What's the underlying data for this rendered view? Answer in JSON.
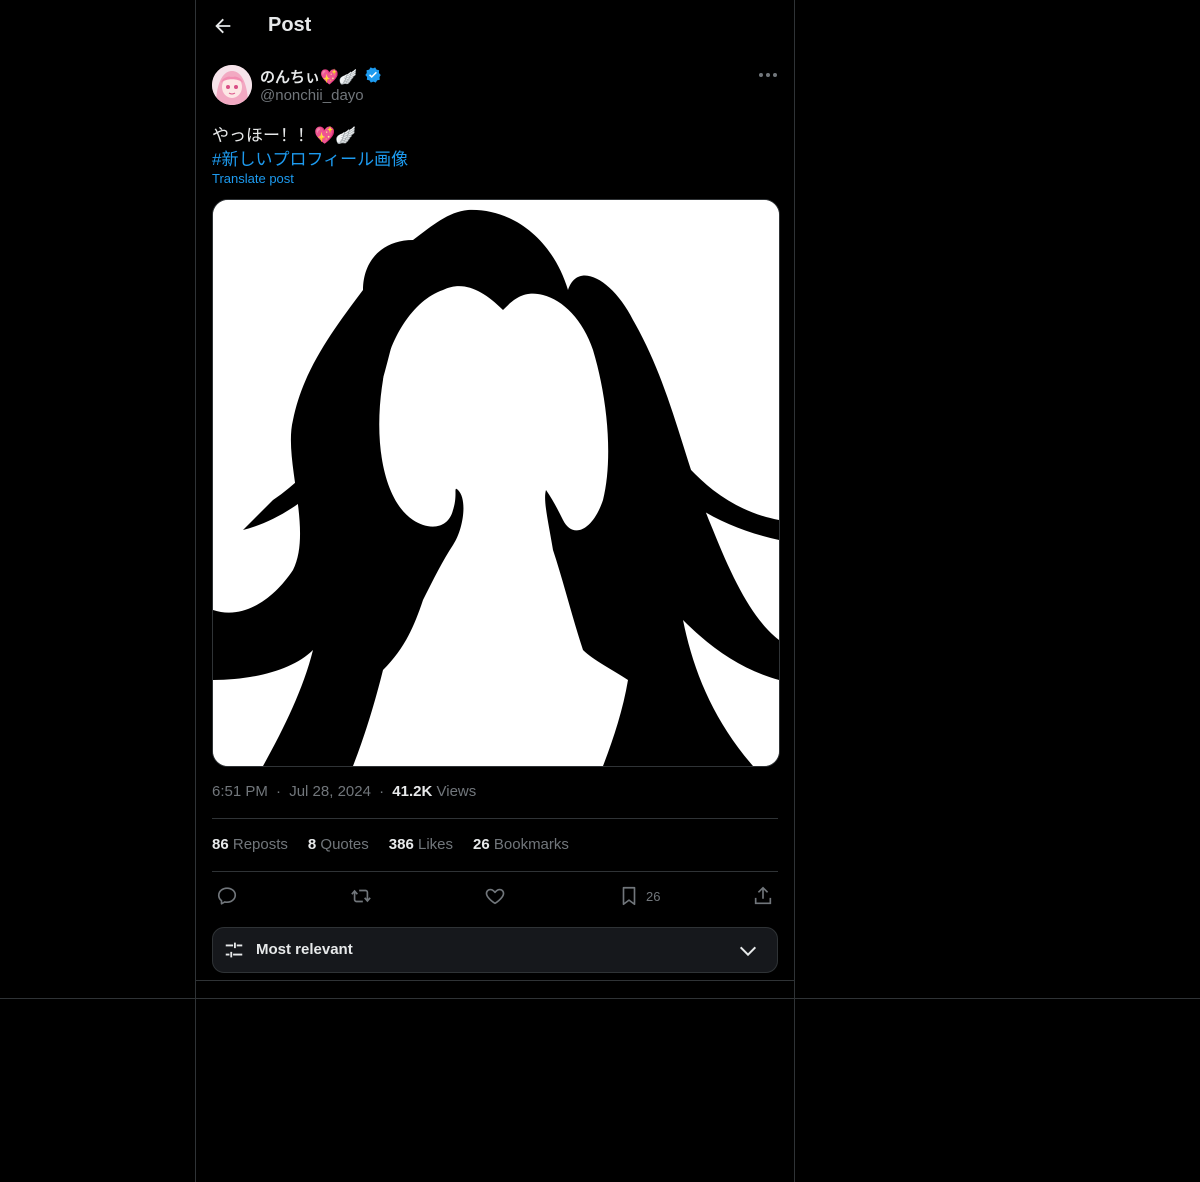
{
  "header": {
    "title": "Post"
  },
  "author": {
    "display_name": "のんちぃ",
    "name_emojis": "💖🪽",
    "handle": "@nonchii_dayo",
    "verified_color": "#1d9bf0"
  },
  "post": {
    "text": "やっほー！！💖🪽",
    "hashtag": "#新しいプロフィール画像",
    "translate_label": "Translate post"
  },
  "meta": {
    "time": "6:51 PM",
    "dot": "·",
    "date": "Jul 28, 2024",
    "views_count": "41.2K",
    "views_label": "Views"
  },
  "stats": {
    "reposts_count": "86",
    "reposts_label": "Reposts",
    "quotes_count": "8",
    "quotes_label": "Quotes",
    "likes_count": "386",
    "likes_label": "Likes",
    "bookmarks_count": "26",
    "bookmarks_label": "Bookmarks"
  },
  "actions": {
    "reply_icon": "reply-icon",
    "repost_icon": "repost-icon",
    "like_icon": "heart-icon",
    "bookmark_icon": "bookmark-icon",
    "bookmark_count": "26",
    "share_icon": "share-icon"
  },
  "sort": {
    "label": "Most relevant"
  },
  "colors": {
    "accent": "#1d9bf0",
    "background": "#000000",
    "border": "#2f3336",
    "muted": "#71767b"
  }
}
